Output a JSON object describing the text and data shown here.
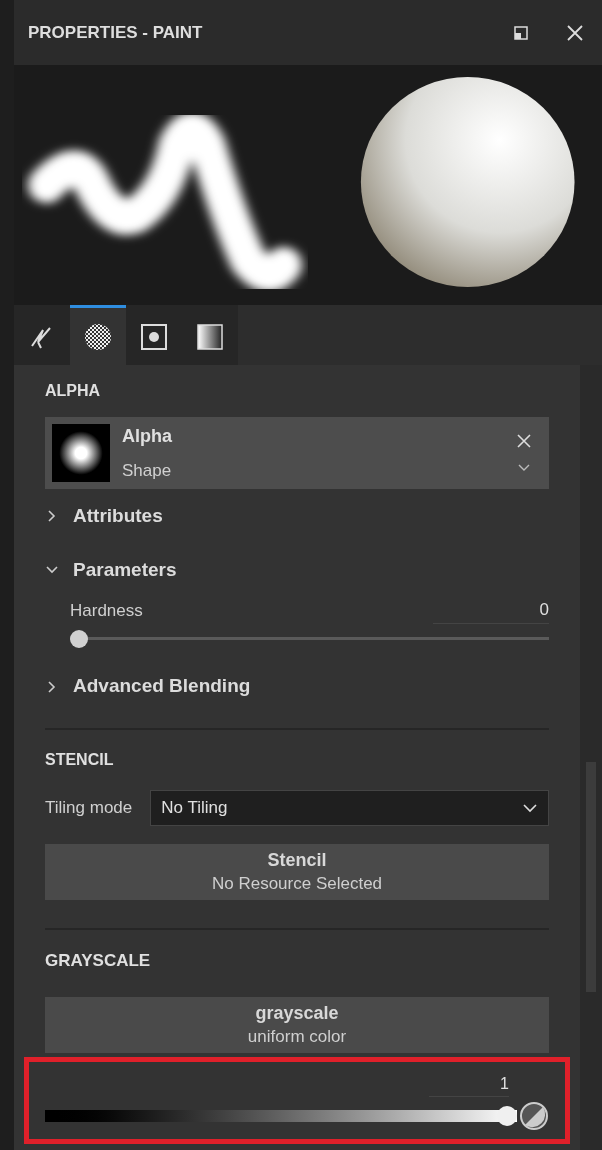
{
  "window": {
    "title": "PROPERTIES - PAINT"
  },
  "tabs": [
    {
      "kind": "brush",
      "selected": false
    },
    {
      "kind": "alpha",
      "selected": true
    },
    {
      "kind": "stencil",
      "selected": false
    },
    {
      "kind": "gradient",
      "selected": false
    }
  ],
  "alpha": {
    "heading": "ALPHA",
    "resource": {
      "name": "Alpha",
      "type": "Shape"
    },
    "groups": [
      {
        "label": "Attributes",
        "expanded": false
      },
      {
        "label": "Parameters",
        "expanded": true,
        "parameter": {
          "label": "Hardness",
          "value": "0",
          "level": 0
        }
      },
      {
        "label": "Advanced Blending",
        "expanded": false
      }
    ]
  },
  "stencil": {
    "heading": "STENCIL",
    "tiling_label": "Tiling mode",
    "tiling_value": "No Tiling",
    "resource": {
      "title": "Stencil",
      "subtitle": "No Resource Selected"
    }
  },
  "grayscale": {
    "heading": "GRAYSCALE",
    "resource": {
      "title": "grayscale",
      "subtitle": "uniform color"
    },
    "value": "1",
    "level": 1
  }
}
